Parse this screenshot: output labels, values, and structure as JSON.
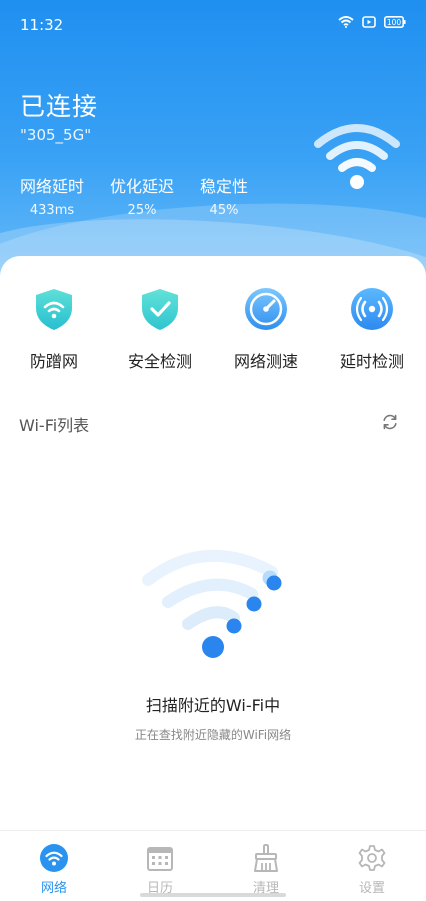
{
  "status": {
    "time": "11:32",
    "battery": "100"
  },
  "connection": {
    "title": "已连接",
    "ssid": "\"305_5G\"",
    "metrics": [
      {
        "label": "网络延时",
        "value": "433ms"
      },
      {
        "label": "优化延迟",
        "value": "25%"
      },
      {
        "label": "稳定性",
        "value": "45%"
      }
    ]
  },
  "tools": [
    {
      "label": "防蹭网",
      "icon": "wifi-shield-icon"
    },
    {
      "label": "安全检测",
      "icon": "check-shield-icon"
    },
    {
      "label": "网络测速",
      "icon": "speedometer-icon"
    },
    {
      "label": "延时检测",
      "icon": "signal-icon"
    }
  ],
  "wifi_list": {
    "title": "Wi-Fi列表"
  },
  "scan": {
    "title": "扫描附近的Wi-Fi中",
    "subtitle": "正在查找附近隐藏的WiFi网络"
  },
  "nav": [
    {
      "label": "网络",
      "icon": "wifi-nav-icon",
      "active": true
    },
    {
      "label": "日历",
      "icon": "calendar-icon",
      "active": false
    },
    {
      "label": "清理",
      "icon": "broom-icon",
      "active": false
    },
    {
      "label": "设置",
      "icon": "gear-icon",
      "active": false
    }
  ],
  "colors": {
    "accent": "#2a93f0",
    "inactive": "#b7b7b7"
  }
}
